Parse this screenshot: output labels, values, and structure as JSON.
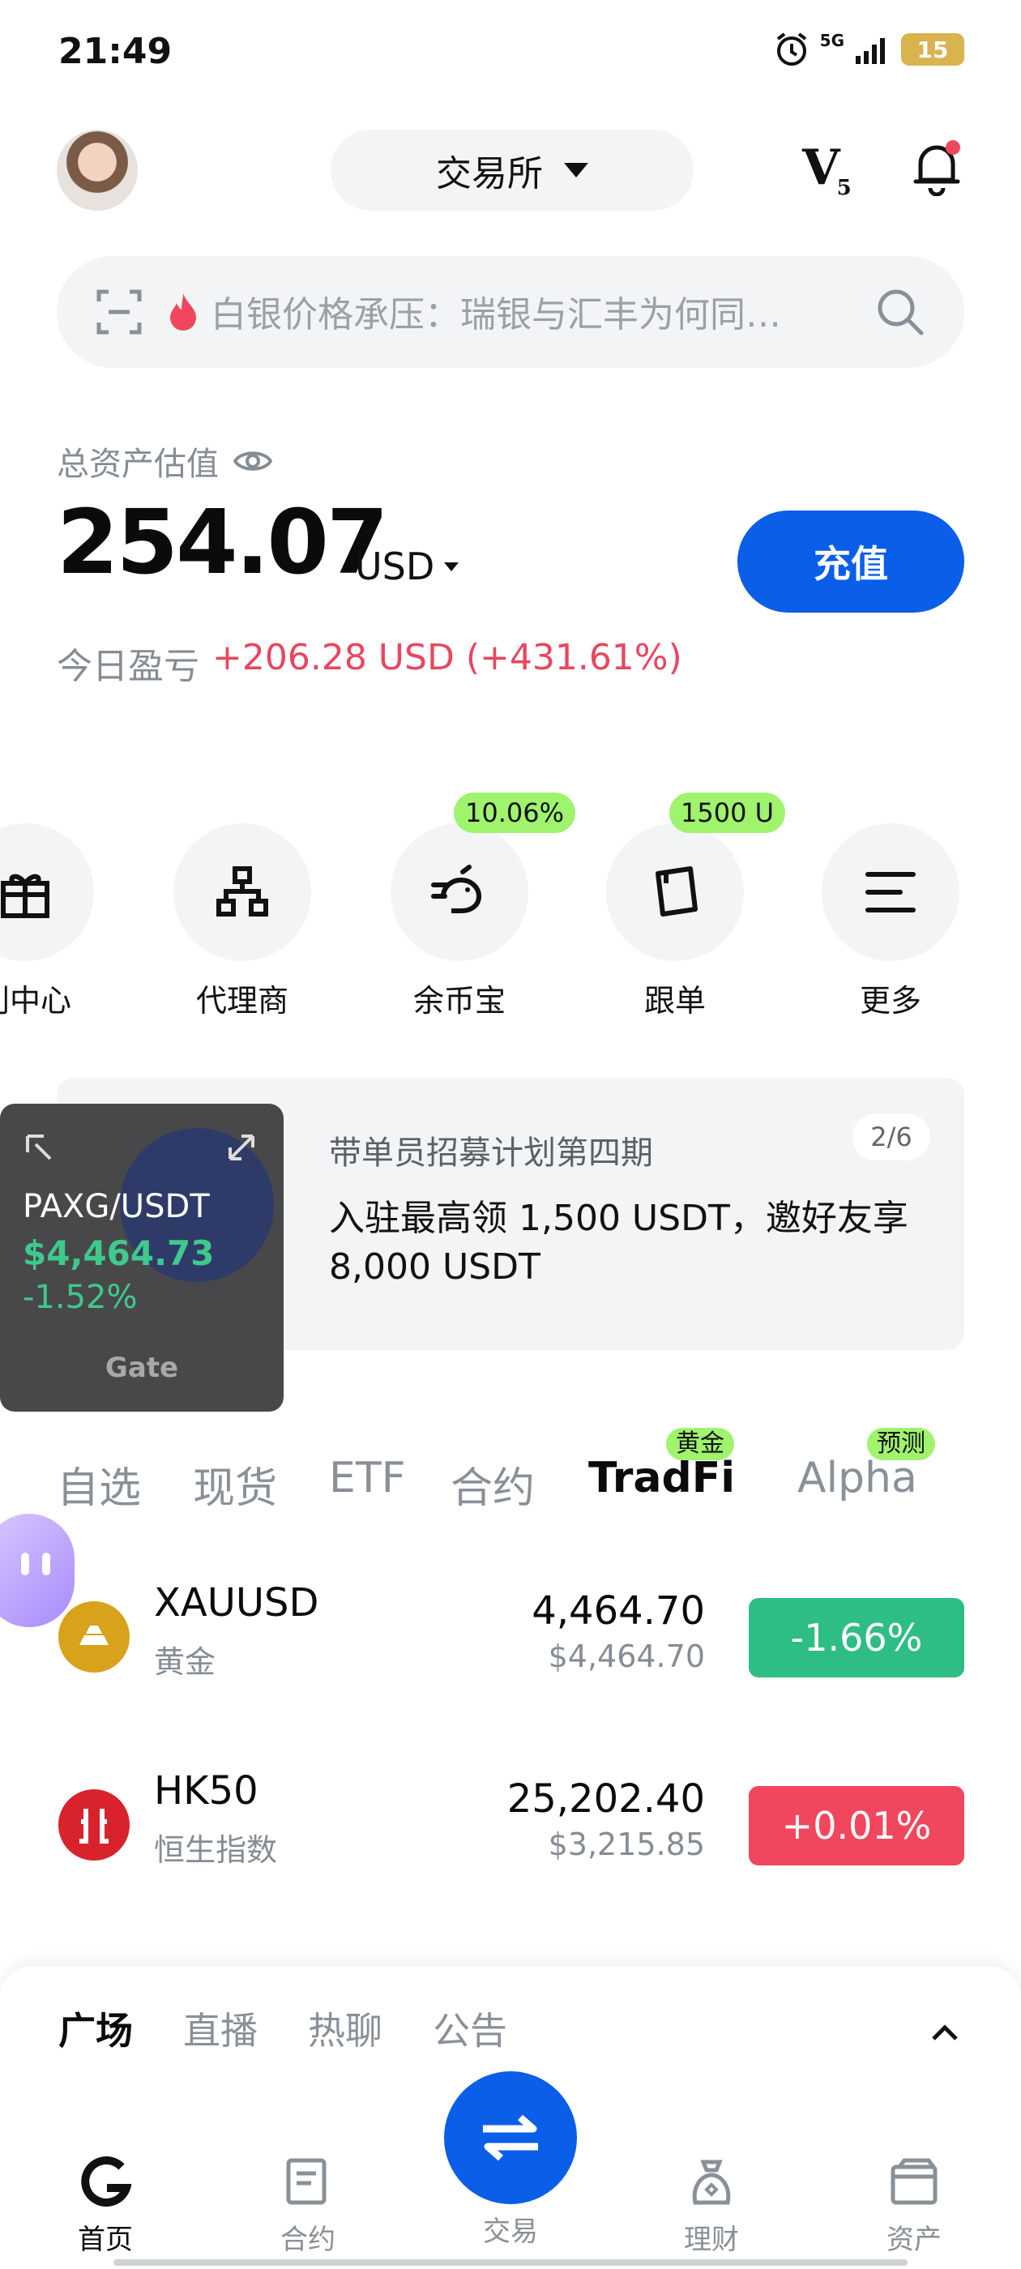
{
  "status_bar": {
    "time": "21:49",
    "network": "5G",
    "battery": "15"
  },
  "header": {
    "exchange_label": "交易所",
    "vip_level": "V",
    "vip_sub": "5"
  },
  "search": {
    "placeholder": "白银价格承压：瑞银与汇丰为何同…"
  },
  "assets": {
    "label": "总资产估值",
    "value": "254.07",
    "currency": "USD",
    "deposit_label": "充值",
    "pnl_label": "今日盈亏",
    "pnl_value": "+206.28 USD (+431.61%)"
  },
  "quick_actions": [
    {
      "label": "利中心",
      "icon": "gift-icon"
    },
    {
      "label": "代理商",
      "icon": "org-chart-icon"
    },
    {
      "label": "余币宝",
      "icon": "piggy-bank-icon",
      "tag": "10.06%"
    },
    {
      "label": "跟单",
      "icon": "copy-trade-icon",
      "tag": "1500 U"
    },
    {
      "label": "更多",
      "icon": "menu-icon"
    }
  ],
  "banner": {
    "title": "带单员招募计划第四期",
    "body": "入驻最高领 1,500 USDT，邀好友享 8,000 USDT",
    "page": "2/6"
  },
  "floating_widget": {
    "pair": "PAXG/USDT",
    "price": "$4,464.73",
    "change": "-1.52%",
    "brand": "Gate"
  },
  "market_tabs": [
    {
      "label": "自选"
    },
    {
      "label": "现货"
    },
    {
      "label": "ETF"
    },
    {
      "label": "合约"
    },
    {
      "label": "TradFi",
      "tag": "黄金",
      "active": true
    },
    {
      "label": "Alpha",
      "tag": "预测"
    }
  ],
  "market_rows": [
    {
      "symbol": "XAUUSD",
      "name": "黄金",
      "price": "4,464.70",
      "usd": "$4,464.70",
      "change": "-1.66%",
      "color": "#2ebd85"
    },
    {
      "symbol": "HK50",
      "name": "恒生指数",
      "price": "25,202.40",
      "usd": "$3,215.85",
      "change": "+0.01%",
      "color": "#f0475e"
    }
  ],
  "feed_tabs": [
    "广场",
    "直播",
    "热聊",
    "公告"
  ],
  "bottom_nav": [
    {
      "label": "首页",
      "icon": "home-icon"
    },
    {
      "label": "合约",
      "icon": "futures-icon"
    },
    {
      "label": "交易",
      "icon": "swap-icon"
    },
    {
      "label": "理财",
      "icon": "finance-icon"
    },
    {
      "label": "资产",
      "icon": "wallet-icon"
    }
  ],
  "colors": {
    "accent": "#0a5ee8",
    "up": "#2ebd85",
    "down": "#f0475e",
    "tag": "#9ff36d"
  }
}
